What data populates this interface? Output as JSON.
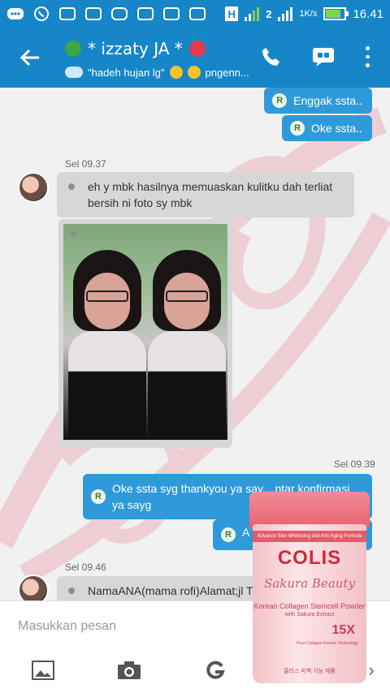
{
  "status_bar": {
    "time": "16.41",
    "network": "H",
    "network_2": "2",
    "speed": "1K/s",
    "icons": [
      "message-dots-icon",
      "whatsapp-icon",
      "bbm-icon",
      "gallery-icon",
      "instagram-icon",
      "bbm-icon",
      "bbm-icon",
      "bbm-icon"
    ]
  },
  "header": {
    "title": "* izzaty JA *",
    "subtitle": "\"hadeh hujan lg\"",
    "subtitle_2": "pngenn...",
    "accent": "#1686c9"
  },
  "messages": [
    {
      "type": "outgoing",
      "text": "Enggak ssta..",
      "badge": "R"
    },
    {
      "type": "outgoing",
      "text": "Oke ssta..",
      "badge": "R"
    },
    {
      "type": "timestamp",
      "text": "Sel 09.37"
    },
    {
      "type": "incoming",
      "text": "eh y mbk hasilnya memuaskan kulitku dah terliat bersih ni foto sy mbk"
    },
    {
      "type": "image",
      "alt": "two-women-photo"
    },
    {
      "type": "timestamp",
      "text": "Sel 09.39"
    },
    {
      "type": "outgoing",
      "text": "Oke ssta syg thankyou ya say....ntar konfirmasi ya sayg",
      "badge": "R"
    },
    {
      "type": "outgoing",
      "text": "A",
      "badge": "R"
    },
    {
      "type": "timestamp",
      "text": "Sel 09.46"
    },
    {
      "type": "incoming",
      "text": "NamaANA(mama rofi)Alamat;jl Tin"
    }
  ],
  "product": {
    "band": "Advance Skin Whitening and Anti Aging Formula",
    "logo": "COLIS",
    "script": "Sakura Beauty",
    "line1": "Korean Collagen Stemcell Powder",
    "line2": "with Sakura Extract",
    "multiplier": "15X",
    "small": "Pure Collagen Korean Technology",
    "korean": "콜리스 미백 기능 제품"
  },
  "input": {
    "placeholder": "Masukkan pesan"
  },
  "toolbar": {
    "icons": [
      "image-icon",
      "camera-icon",
      "google-icon",
      "more-icon"
    ]
  }
}
